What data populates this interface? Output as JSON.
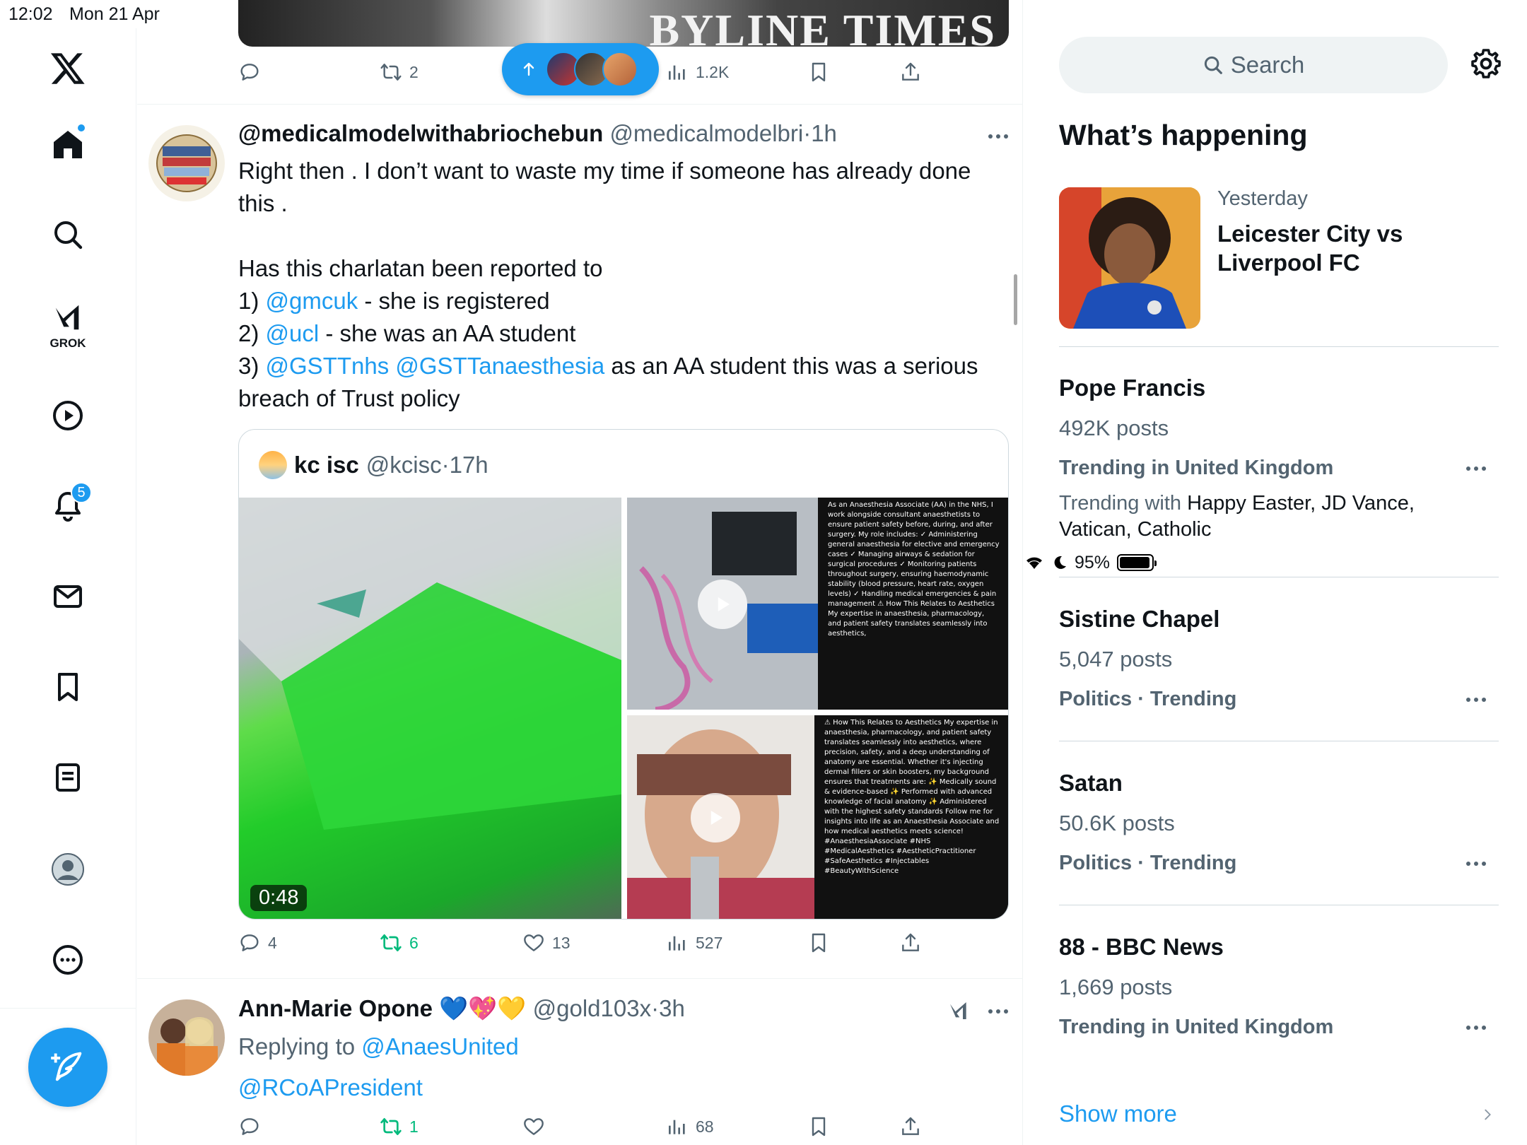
{
  "status_bar": {
    "time": "12:02",
    "date": "Mon 21 Apr",
    "battery": "95%",
    "battery_level": 0.95
  },
  "nav": {
    "home_has_dot": true,
    "grok_label": "GROK",
    "notifications_badge": "5"
  },
  "feed": {
    "top_post": {
      "media_brand": "BYLINE TIMES",
      "retweets": "2",
      "views": "1.2K"
    },
    "tweet1": {
      "name": "@medicalmodelwithabriochebun",
      "handle": "@medicalmodelbri",
      "sep": "·",
      "time": "1h",
      "line1": "Right then . I don’t want to waste my time if someone has already done",
      "line2": "this .",
      "line3": "Has this charlatan been reported to",
      "item1_num": "1)",
      "item1_mention": "@gmcuk",
      "item1_rest": " - she is registered",
      "item2_num": "2)",
      "item2_mention": "@ucl",
      "item2_rest": " - she was an AA student",
      "item3_num": "3)",
      "item3_mention": "@GSTTnhs @GSTTanaesthesia",
      "item3_rest": " as an AA student this was a serious",
      "line_last": "breach of Trust policy",
      "quote": {
        "name": "kc isc",
        "handle": "@kcisc",
        "sep": "·",
        "time": "17h",
        "video_duration": "0:48",
        "caption_1": "As an Anaesthesia Associate (AA) in the NHS, I work alongside consultant anaesthetists to ensure patient safety before, during, and after surgery. My role includes: ✓ Administering general anaesthesia for elective and emergency cases ✓ Managing airways & sedation for surgical procedures ✓ Monitoring patients throughout surgery, ensuring haemodynamic stability (blood pressure, heart rate, oxygen levels) ✓ Handling medical emergencies & pain management ⚠ How This Relates to Aesthetics My expertise in anaesthesia, pharmacology, and patient safety translates seamlessly into aesthetics,",
        "caption_2": "⚠ How This Relates to Aesthetics My expertise in anaesthesia, pharmacology, and patient safety translates seamlessly into aesthetics, where precision, safety, and a deep understanding of anatomy are essential. Whether it's injecting dermal fillers or skin boosters, my background ensures that treatments are: ✨ Medically sound & evidence-based ✨ Performed with advanced knowledge of facial anatomy ✨ Administered with the highest safety standards Follow me for insights into life as an Anaesthesia Associate and how medical aesthetics meets science! #AnaesthesiaAssociate #NHS #MedicalAesthetics #AestheticPractitioner #SafeAesthetics #Injectables #BeautyWithScience"
      },
      "replies": "4",
      "retweets": "6",
      "likes": "13",
      "views": "527"
    },
    "tweet2": {
      "name": "Ann-Marie Opone",
      "emojis": "💙💖💛",
      "handle": "@gold103x",
      "sep": "·",
      "time": "3h",
      "replying_label": "Replying to",
      "replying_to": "@AnaesUnited",
      "text": "@RCoAPresident",
      "retweets": "1",
      "views": "68"
    }
  },
  "sidebar": {
    "search_placeholder": "Search",
    "heading": "What’s happening",
    "featured": {
      "when": "Yesterday",
      "title": "Leicester City vs Liverpool FC"
    },
    "trends": [
      {
        "title": "Pope Francis",
        "count": "492K posts",
        "context": "Trending in United Kingdom",
        "with_label": "Trending with",
        "with": "Happy Easter, JD Vance, Vatican, Catholic"
      },
      {
        "title": "Sistine Chapel",
        "count": "5,047 posts",
        "context": "Politics · Trending"
      },
      {
        "title": "Satan",
        "count": "50.6K posts",
        "context": "Politics · Trending"
      },
      {
        "title": "88 - BBC News",
        "count": "1,669 posts",
        "context": "Trending in United Kingdom"
      }
    ],
    "show_more": "Show more"
  }
}
